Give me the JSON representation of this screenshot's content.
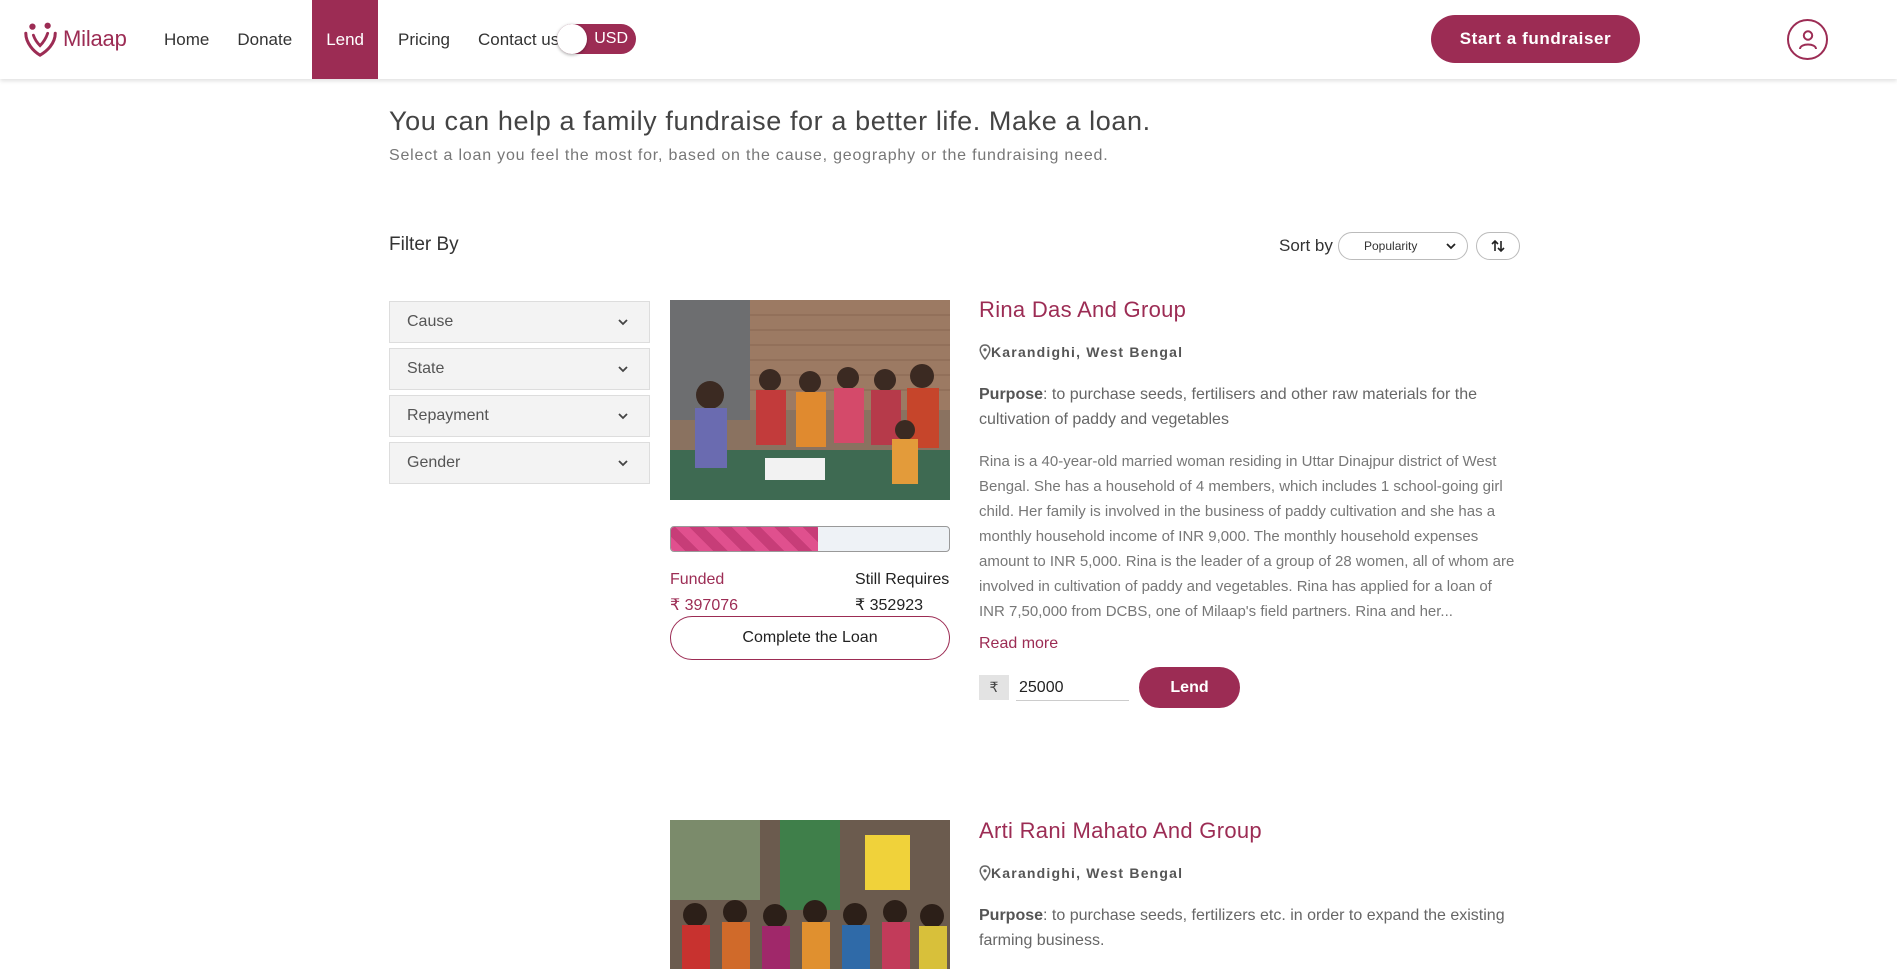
{
  "header": {
    "logo_text": "Milaap",
    "nav": [
      {
        "label": "Home"
      },
      {
        "label": "Donate"
      },
      {
        "label": "Lend",
        "active": true
      },
      {
        "label": "Pricing"
      },
      {
        "label": "Contact us"
      }
    ],
    "currency_toggle": "USD",
    "cta": "Start a fundraiser",
    "brand_color": "#9c2c54"
  },
  "intro": {
    "headline": "You can help a family fundraise for a better life. Make a loan.",
    "subline": "Select a loan you feel the most for, based on the cause, geography or the fundraising need."
  },
  "filters": {
    "title": "Filter By",
    "items": [
      {
        "label": "Cause"
      },
      {
        "label": "State"
      },
      {
        "label": "Repayment"
      },
      {
        "label": "Gender"
      }
    ]
  },
  "sort": {
    "label": "Sort by",
    "selected": "Popularity"
  },
  "loans": [
    {
      "name": "Rina Das And Group",
      "location": "Karandighi, West Bengal",
      "purpose_label": "Purpose",
      "purpose": ": to purchase seeds, fertilisers and other raw materials for the cultivation of paddy and vegetables",
      "story": "Rina is a 40-year-old married woman residing in Uttar Dinajpur district of West Bengal. She has a household of 4 members, which includes 1 school-going girl child. Her family is involved in the business of paddy cultivation and she has a monthly household income of INR 9,000. The monthly household expenses amount to INR 5,000. Rina is the leader of a group of 28 women, all of whom are involved in cultivation of paddy and vegetables. Rina has applied for a loan of INR 7,50,000 from DCBS, one of Milaap's field partners. Rina and her...",
      "read_more": "Read more",
      "funded_label": "Funded",
      "funded": "₹ 397076",
      "requires_label": "Still Requires",
      "requires": "₹ 352923",
      "funded_fraction": 0.53,
      "complete_label": "Complete the Loan",
      "currency_symbol": "₹",
      "amount": "25000",
      "lend_label": "Lend"
    },
    {
      "name": "Arti Rani Mahato And Group",
      "location": "Karandighi, West Bengal",
      "purpose_label": "Purpose",
      "purpose": ": to purchase seeds, fertilizers etc. in order to expand the existing farming business."
    }
  ]
}
